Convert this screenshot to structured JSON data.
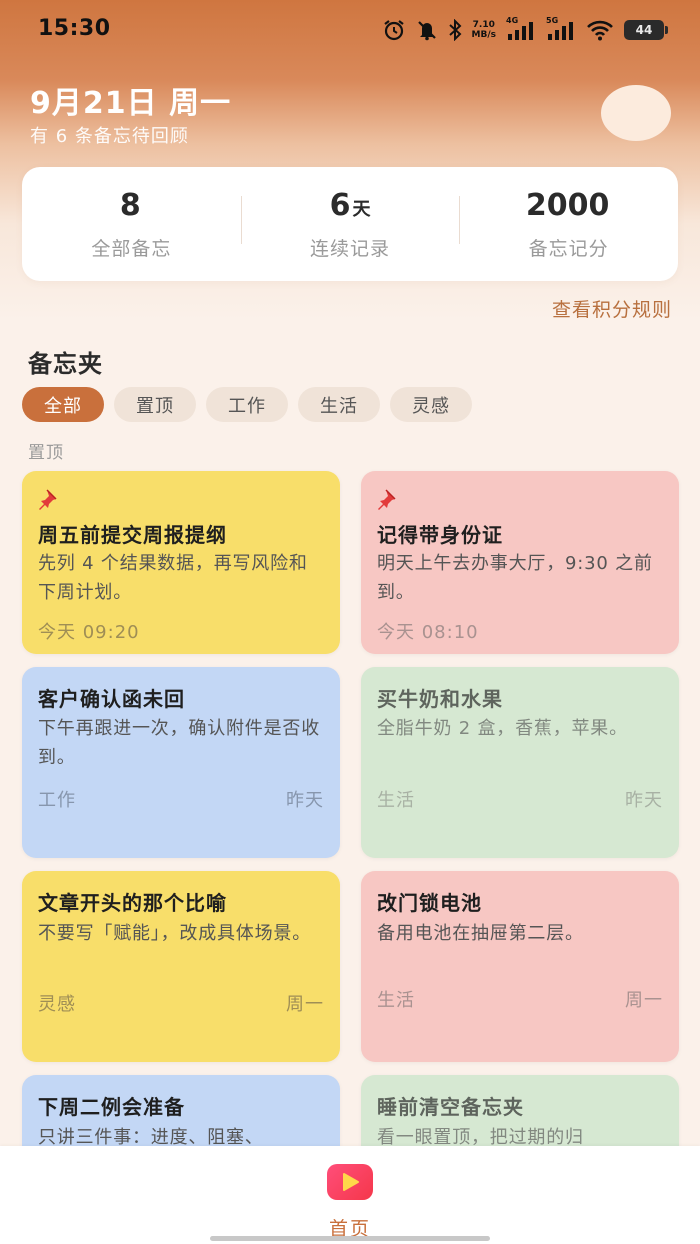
{
  "status_bar": {
    "time": "15:30",
    "net_speed_top": "7.10",
    "net_speed_bottom": "MB/s",
    "signal1_label": "4G",
    "signal2_label": "5G",
    "battery": "44",
    "icons": [
      "alarm-icon",
      "mute-icon",
      "bluetooth-icon",
      "signal-4g-icon",
      "signal-5g-icon",
      "wifi-icon",
      "battery-icon"
    ]
  },
  "header": {
    "date": "9月21日 周一",
    "subtitle": "有 6 条备忘待回顾"
  },
  "stats": [
    {
      "value": "8",
      "unit": "",
      "label": "全部备忘"
    },
    {
      "value": "6",
      "unit": "天",
      "label": "连续记录"
    },
    {
      "value": "2000",
      "unit": "",
      "label": "备忘记分"
    }
  ],
  "rules_link": "查看积分规则",
  "section_title": "备忘夹",
  "filters": [
    {
      "label": "全部",
      "active": true
    },
    {
      "label": "置顶",
      "active": false
    },
    {
      "label": "工作",
      "active": false
    },
    {
      "label": "生活",
      "active": false
    },
    {
      "label": "灵感",
      "active": false
    }
  ],
  "group_label": "置顶",
  "notes": [
    {
      "title": "周五前提交周报提纲",
      "body": "先列 4 个结果数据，再写风险和下周计划。",
      "foot_left": "今天 09:20",
      "foot_right": "",
      "color": "#F8DE6A",
      "pinned": true
    },
    {
      "title": "记得带身份证",
      "body": "明天上午去办事大厅，9:30 之前到。",
      "foot_left": "今天 08:10",
      "foot_right": "",
      "color": "#F7C7C3",
      "pinned": true
    },
    {
      "title": "客户确认函未回",
      "body": "下午再跟进一次，确认附件是否收到。",
      "foot_left": "工作",
      "foot_right": "昨天",
      "color": "#C3D7F5",
      "pinned": false
    },
    {
      "title": "买牛奶和水果",
      "body": "全脂牛奶 2 盒，香蕉，苹果。",
      "foot_left": "生活",
      "foot_right": "昨天",
      "color": "#D6E8D2",
      "pinned": false
    },
    {
      "title": "文章开头的那个比喻",
      "body": "不要写「赋能」，改成具体场景。",
      "foot_left": "灵感",
      "foot_right": "周一",
      "color": "#F8DE6A",
      "pinned": false
    },
    {
      "title": "改门锁电池",
      "body": "备用电池在抽屉第二层。",
      "foot_left": "生活",
      "foot_right": "周一",
      "color": "#F7C7C3",
      "pinned": false
    },
    {
      "title": "下周二例会准备",
      "body": "只讲三件事：进度、阻塞、",
      "foot_left": "",
      "foot_right": "",
      "color": "#C3D7F5",
      "pinned": false
    },
    {
      "title": "睡前清空备忘夹",
      "body": "看一眼置顶，把过期的归",
      "foot_left": "",
      "foot_right": "",
      "color": "#D6E8D2",
      "pinned": false
    }
  ],
  "bottom_nav": {
    "home_label": "首页",
    "home_icon": "play-icon"
  }
}
